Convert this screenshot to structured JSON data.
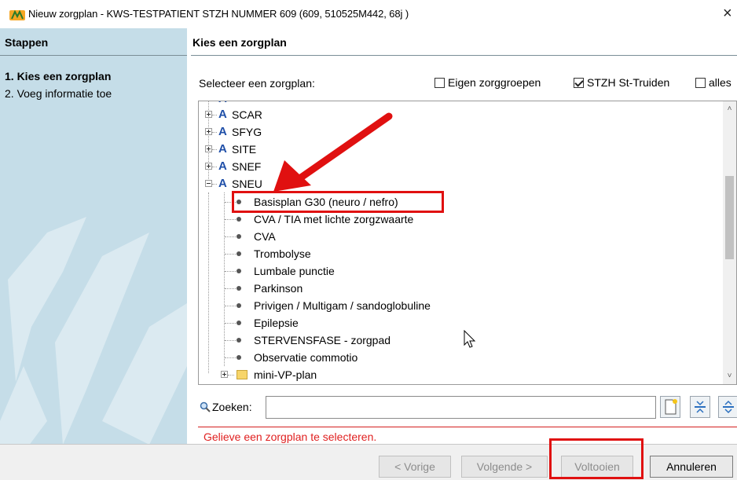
{
  "window": {
    "title": "Nieuw zorgplan - KWS-TESTPATIENT STZH NUMMER 609  (609, 510525M442, 68j )",
    "close_glyph": "×"
  },
  "steps": {
    "header": "Stappen",
    "items": [
      {
        "label": "1. Kies een zorgplan",
        "active": true
      },
      {
        "label": "2. Voeg informatie toe",
        "active": false
      }
    ]
  },
  "main": {
    "header": "Kies een zorgplan",
    "select_label": "Selecteer een zorgplan:",
    "filters": [
      {
        "label": "Eigen zorggroepen",
        "checked": false
      },
      {
        "label": "STZH St-Truiden",
        "checked": true
      },
      {
        "label": "alles",
        "checked": false
      }
    ],
    "tree": {
      "groups": [
        {
          "label": "SCAR",
          "expanded": false
        },
        {
          "label": "SFYG",
          "expanded": false
        },
        {
          "label": "SITE",
          "expanded": false
        },
        {
          "label": "SNEF",
          "expanded": false
        },
        {
          "label": "SNEU",
          "expanded": true
        }
      ],
      "children": [
        "Basisplan G30 (neuro / nefro)",
        "CVA / TIA met lichte zorgzwaarte",
        "CVA",
        "Trombolyse",
        "Lumbale punctie",
        "Parkinson",
        "Privigen / Multigam / sandoglobuline",
        "Epilepsie",
        "STERVENSFASE - zorgpad",
        "Observatie commotio"
      ],
      "folder": "mini-VP-plan",
      "group_icon_letter": "A"
    },
    "search": {
      "label": "Zoeken:",
      "value": "",
      "placeholder": ""
    },
    "error": "Gelieve een zorgplan te selecteren."
  },
  "footer": {
    "buttons": [
      {
        "label": "< Vorige",
        "enabled": false
      },
      {
        "label": "Volgende >",
        "enabled": false
      },
      {
        "label": "Voltooien",
        "enabled": false
      },
      {
        "label": "Annuleren",
        "enabled": true
      }
    ]
  },
  "colors": {
    "steps_panel": "#c5dde8",
    "annotation_red": "#e01010",
    "error_red": "#e02020",
    "group_icon_blue": "#1f4fa8"
  },
  "icons": [
    "app-logo-icon",
    "close-icon",
    "expand-icon",
    "collapse-icon",
    "group-a-icon",
    "leaf-dot-icon",
    "folder-icon",
    "search-icon",
    "new-document-icon",
    "collapse-all-icon",
    "expand-all-icon",
    "mouse-cursor-icon",
    "scroll-up-icon",
    "scroll-down-icon"
  ]
}
